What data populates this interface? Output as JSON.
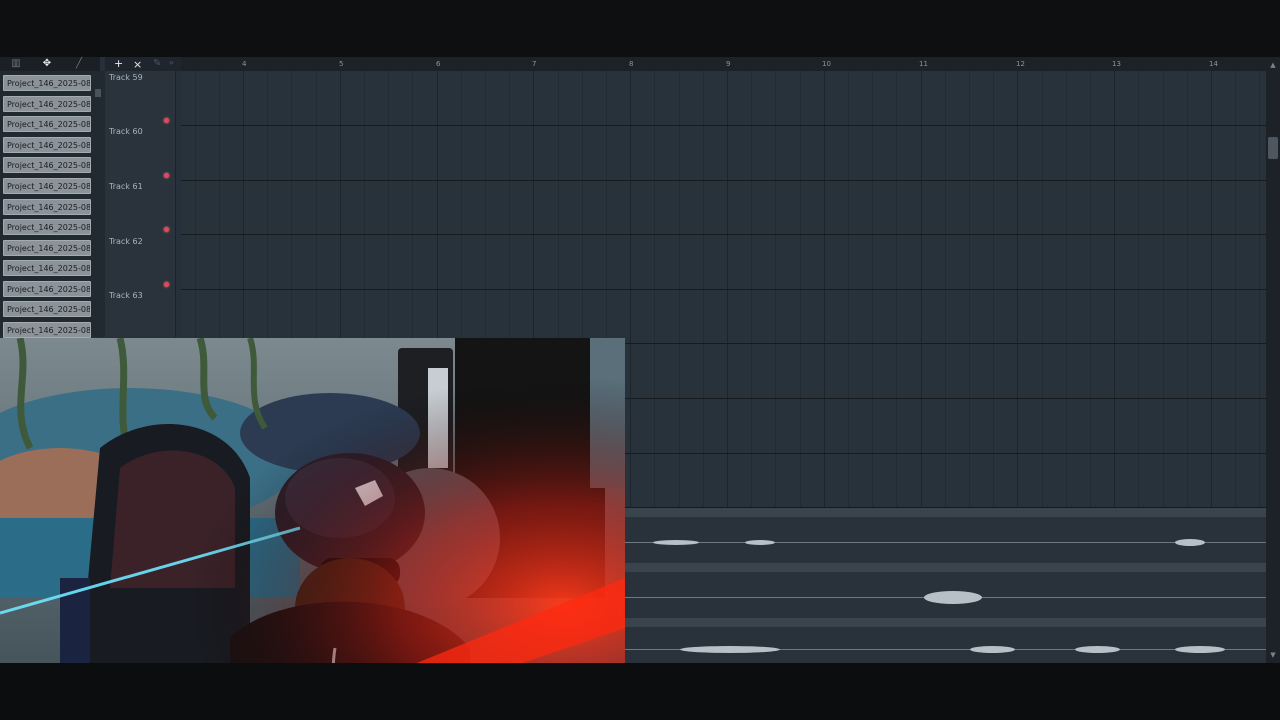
{
  "picker": {
    "clips": [
      "Project_146_2025-08-05...",
      "Project_146_2025-08-05...",
      "Project_146_2025-08-05...",
      "Project_146_2025-08-05...",
      "Project_146_2025-08-05...",
      "Project_146_2025-08-05...",
      "Project_146_2025-08-05...",
      "Project_146_2025-08-05...",
      "Project_146_2025-08-05...",
      "Project_146_2025-08-05...",
      "Project_146_2025-08-05...",
      "Project_146_2025-08-05...",
      "Project_146_2025-08-05..."
    ]
  },
  "toolbar": {
    "icons": [
      "piano-roll-icon",
      "move-arrows-icon",
      "pencil-icon"
    ],
    "add_label": "+",
    "close_label": "×",
    "pen_label": "✎",
    "arrow_label": "»"
  },
  "tracks": [
    "Track 59",
    "Track 60",
    "Track 61",
    "Track 62",
    "Track 63"
  ],
  "ruler": [
    "4",
    "5",
    "6",
    "7",
    "8",
    "9",
    "10",
    "11",
    "12",
    "13",
    "14"
  ],
  "scroll": {
    "up": "▲",
    "down": "▼"
  },
  "colors": {
    "mute_dot": "#e2475a",
    "grid": "#28323b",
    "clip": "#8b9299"
  }
}
